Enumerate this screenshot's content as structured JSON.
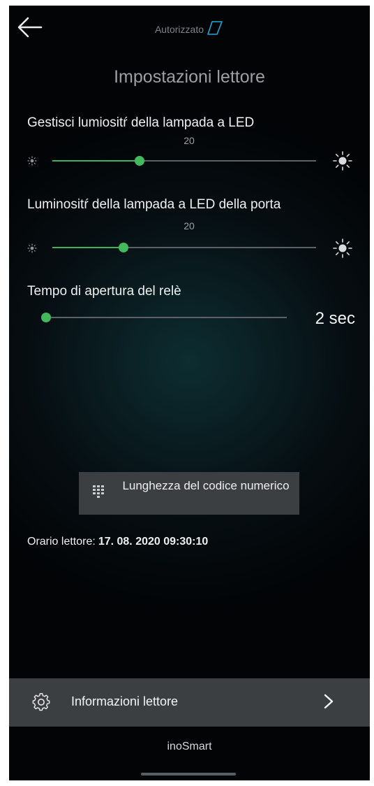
{
  "header": {
    "back_icon": "arrow-left-icon",
    "status_label": "Autorizzato",
    "status_icon": "outline-tag-icon",
    "status_icon_color": "#1fa9d6"
  },
  "page": {
    "title": "Impostazioni lettore"
  },
  "led_brightness": {
    "label": "Gestisci lumiositŕ della lampada a LED",
    "value": "20",
    "level_fraction": 0.33,
    "min_icon": "sun-small-icon",
    "max_icon": "sun-large-icon"
  },
  "door_led_brightness": {
    "label": "Luminositŕ della lampada a LED della porta",
    "value": "20",
    "level_fraction": 0.27,
    "min_icon": "sun-small-icon",
    "max_icon": "sun-large-icon"
  },
  "relay_time": {
    "label": "Tempo di apertura del relè",
    "value": "2 sec",
    "level_fraction": 0.0
  },
  "code_length_button": {
    "label": "Lunghezza del codice numerico",
    "icon": "keypad-icon"
  },
  "reader_time": {
    "label": "Orario lettore:",
    "value": "17. 08. 2020 09:30:10"
  },
  "info_bar": {
    "label": "Informazioni lettore",
    "icon": "gear-icon",
    "chevron": "chevron-right-icon"
  },
  "footer": {
    "brand": "inoSmart"
  },
  "colors": {
    "accent_green": "#43b85d",
    "button_bg": "#3b3f42",
    "background": "#061015"
  }
}
